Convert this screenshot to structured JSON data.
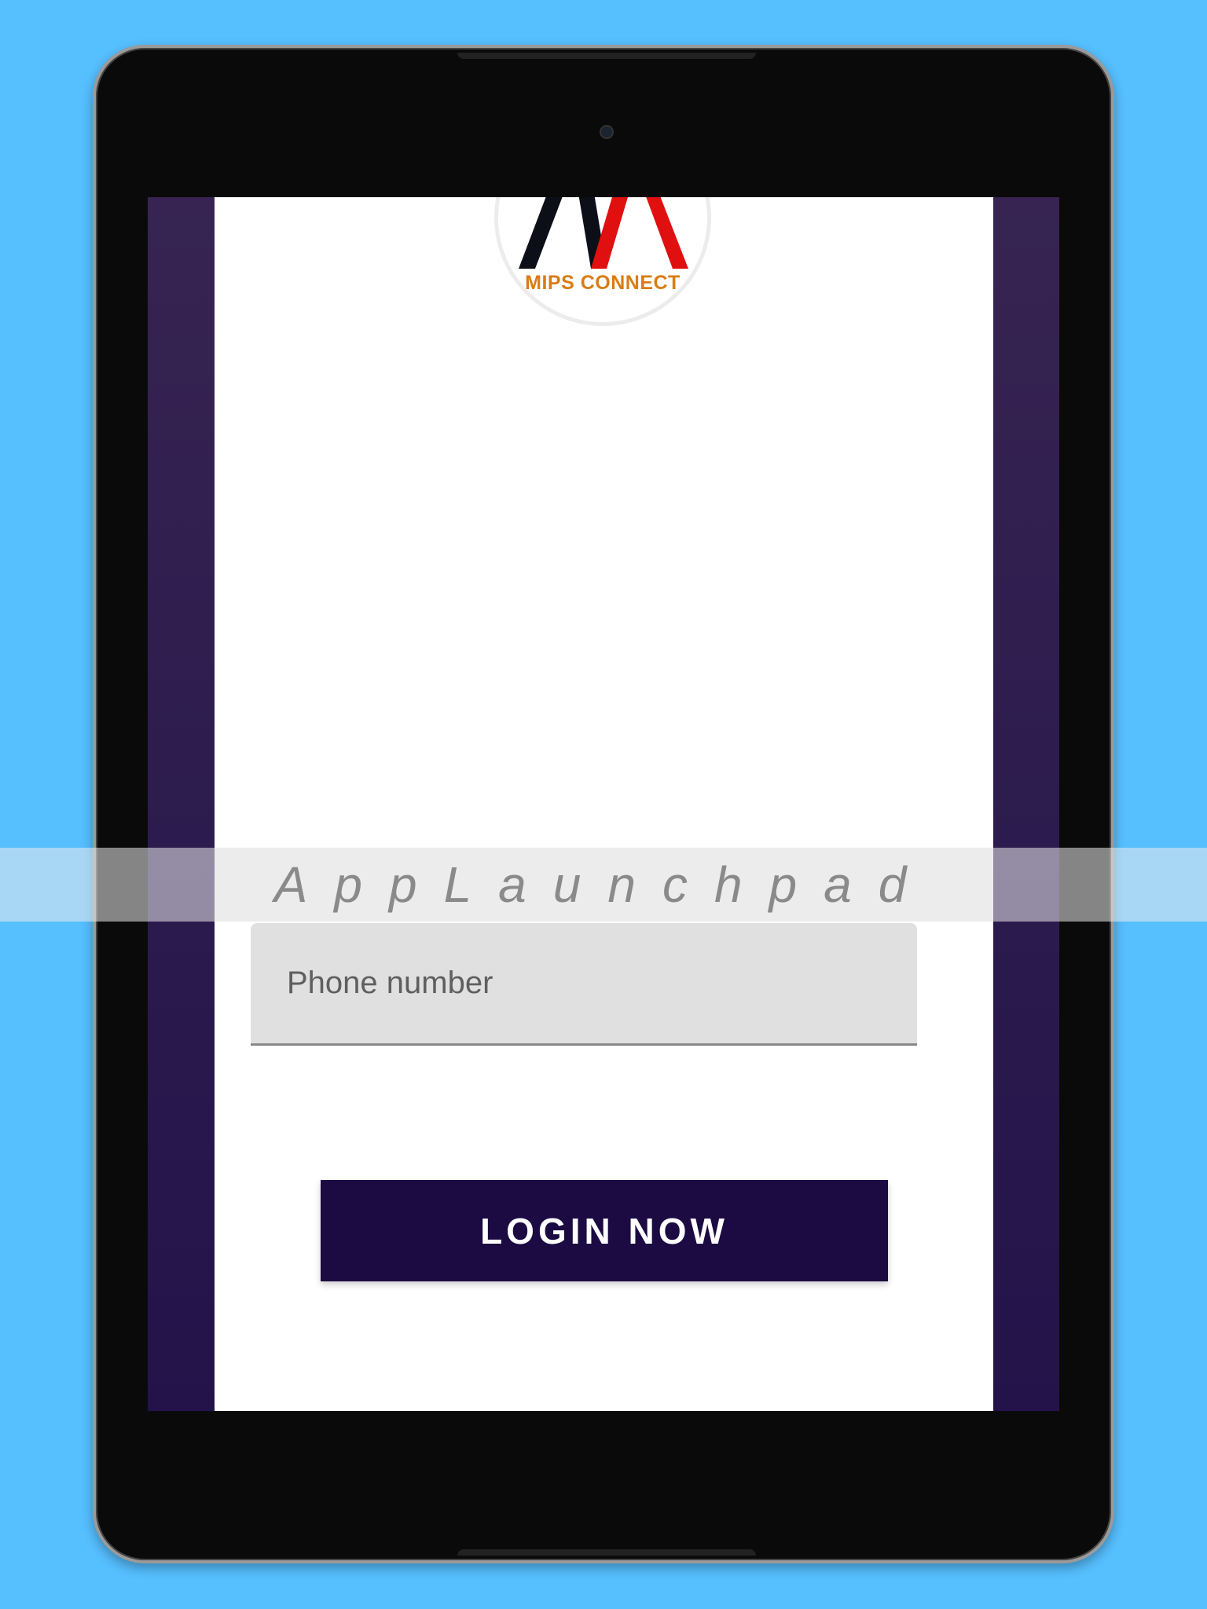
{
  "app": {
    "logo_text": "MIPS CONNECT",
    "colors": {
      "background": "#56bffe",
      "button": "#1b0b42",
      "logo_text": "#d97c14",
      "logo_red": "#e01010",
      "logo_dark": "#0c0f18"
    }
  },
  "login": {
    "phone_placeholder": "Phone number",
    "phone_value": "",
    "login_label": "LOGIN NOW"
  },
  "watermark": {
    "text": "AppLaunchpad"
  }
}
